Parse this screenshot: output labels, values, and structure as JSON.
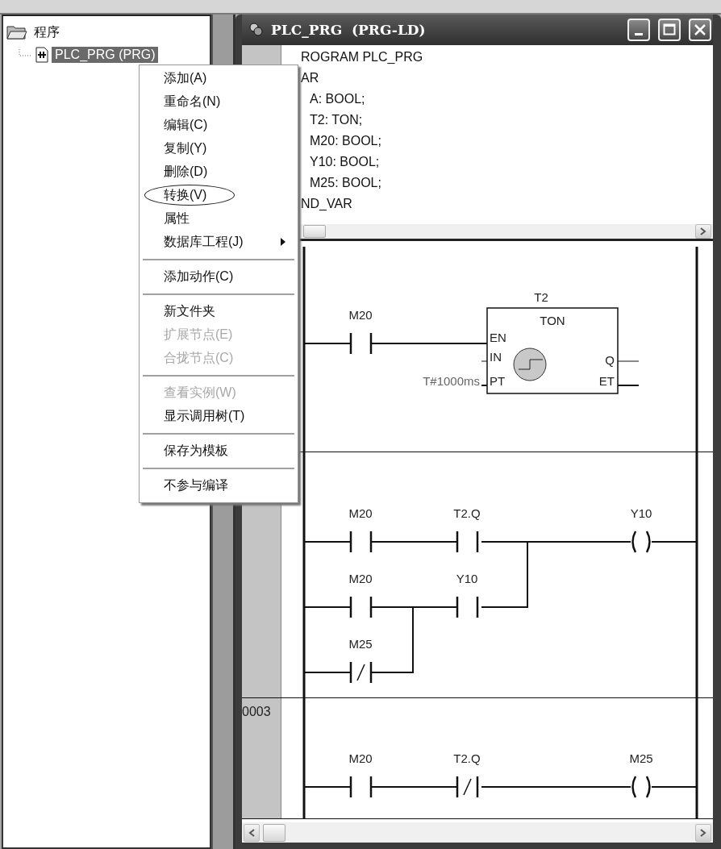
{
  "tree": {
    "items": [
      {
        "label": "程序",
        "expanded": true,
        "selected": false,
        "children": [
          {
            "label": "PLC_PRG (PRG)",
            "selected": true
          }
        ]
      }
    ]
  },
  "context_menu": {
    "items": [
      {
        "kind": "item",
        "label": "添加(A)",
        "disabled": false,
        "circled": false
      },
      {
        "kind": "item",
        "label": "重命名(N)",
        "disabled": false,
        "circled": false
      },
      {
        "kind": "item",
        "label": "编辑(C)",
        "disabled": false,
        "circled": false
      },
      {
        "kind": "item",
        "label": "复制(Y)",
        "disabled": false,
        "circled": false
      },
      {
        "kind": "item",
        "label": "删除(D)",
        "disabled": false,
        "circled": false
      },
      {
        "kind": "item",
        "label": "转换(V)",
        "disabled": false,
        "circled": true
      },
      {
        "kind": "item",
        "label": "属性",
        "disabled": false,
        "circled": false
      },
      {
        "kind": "submenu",
        "label": "数据库工程(J)",
        "disabled": false,
        "circled": false
      },
      {
        "kind": "separator"
      },
      {
        "kind": "item",
        "label": "添加动作(C)",
        "disabled": false,
        "circled": false
      },
      {
        "kind": "separator"
      },
      {
        "kind": "item",
        "label": "新文件夹",
        "disabled": false,
        "circled": false
      },
      {
        "kind": "item",
        "label": "扩展节点(E)",
        "disabled": true,
        "circled": false
      },
      {
        "kind": "item",
        "label": "合拢节点(C)",
        "disabled": true,
        "circled": false
      },
      {
        "kind": "separator"
      },
      {
        "kind": "item",
        "label": "查看实例(W)",
        "disabled": true,
        "circled": false
      },
      {
        "kind": "item",
        "label": "显示调用树(T)",
        "disabled": false,
        "circled": false
      },
      {
        "kind": "separator"
      },
      {
        "kind": "item",
        "label": "保存为模板",
        "disabled": false,
        "circled": false
      },
      {
        "kind": "separator"
      },
      {
        "kind": "item",
        "label": "不参与编译",
        "disabled": false,
        "circled": false
      }
    ]
  },
  "editor": {
    "title": "PLC_PRG  (PRG-LD)",
    "declaration": {
      "lines": [
        {
          "text": "ROGRAM PLC_PRG",
          "indented": false
        },
        {
          "text": "AR",
          "indented": false
        },
        {
          "text": "A: BOOL;",
          "indented": true
        },
        {
          "text": "T2: TON;",
          "indented": true
        },
        {
          "text": "M20: BOOL;",
          "indented": true
        },
        {
          "text": "Y10: BOOL;",
          "indented": true
        },
        {
          "text": "M25: BOOL;",
          "indented": true
        },
        {
          "text": "ND_VAR",
          "indented": false
        }
      ]
    },
    "networks": [
      {
        "elements": [
          {
            "kind": "contact",
            "label": "M20"
          },
          {
            "kind": "function_block",
            "instance": "T2",
            "type": "TON",
            "inputs": [
              "EN",
              "IN",
              "PT"
            ],
            "outputs": [
              "Q",
              "ET"
            ],
            "pt_value": "T#1000ms"
          }
        ]
      },
      {
        "elements": [
          {
            "kind": "contact",
            "label": "M20"
          },
          {
            "kind": "contact",
            "label": "T2.Q"
          },
          {
            "kind": "coil",
            "label": "Y10"
          },
          {
            "kind": "contact",
            "label": "M20"
          },
          {
            "kind": "contact",
            "label": "Y10"
          },
          {
            "kind": "negated_contact",
            "label": "M25"
          }
        ]
      },
      {
        "number": "0003",
        "elements": [
          {
            "kind": "contact",
            "label": "M20"
          },
          {
            "kind": "negated_contact",
            "label": "T2.Q"
          },
          {
            "kind": "coil",
            "label": "M25"
          }
        ]
      }
    ]
  }
}
